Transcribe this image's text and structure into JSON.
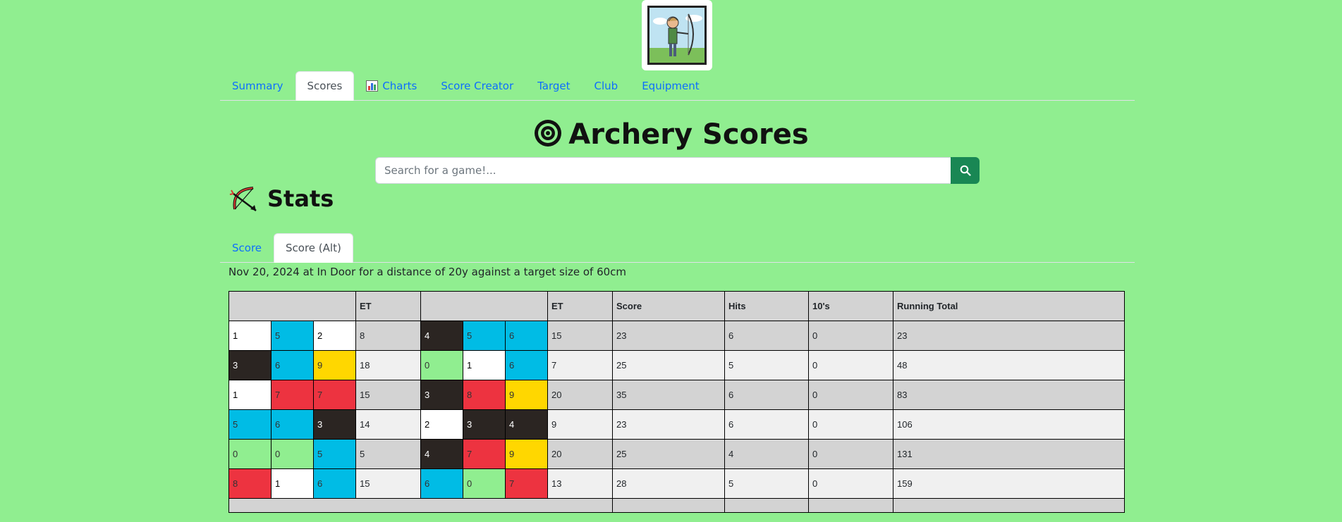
{
  "nav": {
    "tabs": [
      {
        "label": "Summary"
      },
      {
        "label": "Scores",
        "active": true
      },
      {
        "label": "Charts",
        "icon": "bar-chart-icon"
      },
      {
        "label": "Score Creator"
      },
      {
        "label": "Target"
      },
      {
        "label": "Club"
      },
      {
        "label": "Equipment"
      }
    ]
  },
  "page": {
    "title": "Archery Scores",
    "title_icon": "target-icon"
  },
  "search": {
    "placeholder": "Search for a game!...",
    "button_icon": "search-icon"
  },
  "stats": {
    "heading": "Stats",
    "icon": "bow-and-arrow-icon",
    "tabs": [
      {
        "label": "Score"
      },
      {
        "label": "Score (Alt)",
        "active": true
      }
    ],
    "meta": "Nov 20, 2024 at In Door for a distance of 20y against a target size of 60cm"
  },
  "table": {
    "headers": [
      "ET",
      "ET",
      "Score",
      "Hits",
      "10's",
      "Running Total"
    ],
    "colors": {
      "white": "#ffffff",
      "black": "#2b2522",
      "blue": "#00bce5",
      "red": "#ed3340",
      "gold": "#ffd700",
      "miss": "#90ee90"
    },
    "rows": [
      {
        "end1": [
          "1",
          "5",
          "2"
        ],
        "et1": "8",
        "end2": [
          "4",
          "5",
          "6"
        ],
        "et2": "15",
        "score": "23",
        "hits": "6",
        "tens": "0",
        "running": "23"
      },
      {
        "end1": [
          "3",
          "6",
          "9"
        ],
        "et1": "18",
        "end2": [
          "0",
          "1",
          "6"
        ],
        "et2": "7",
        "score": "25",
        "hits": "5",
        "tens": "0",
        "running": "48"
      },
      {
        "end1": [
          "1",
          "7",
          "7"
        ],
        "et1": "15",
        "end2": [
          "3",
          "8",
          "9"
        ],
        "et2": "20",
        "score": "35",
        "hits": "6",
        "tens": "0",
        "running": "83"
      },
      {
        "end1": [
          "5",
          "6",
          "3"
        ],
        "et1": "14",
        "end2": [
          "2",
          "3",
          "4"
        ],
        "et2": "9",
        "score": "23",
        "hits": "6",
        "tens": "0",
        "running": "106"
      },
      {
        "end1": [
          "0",
          "0",
          "5"
        ],
        "et1": "5",
        "end2": [
          "4",
          "7",
          "9"
        ],
        "et2": "20",
        "score": "25",
        "hits": "4",
        "tens": "0",
        "running": "131"
      },
      {
        "end1": [
          "8",
          "1",
          "6"
        ],
        "et1": "15",
        "end2": [
          "6",
          "0",
          "7"
        ],
        "et2": "13",
        "score": "28",
        "hits": "5",
        "tens": "0",
        "running": "159"
      }
    ]
  }
}
